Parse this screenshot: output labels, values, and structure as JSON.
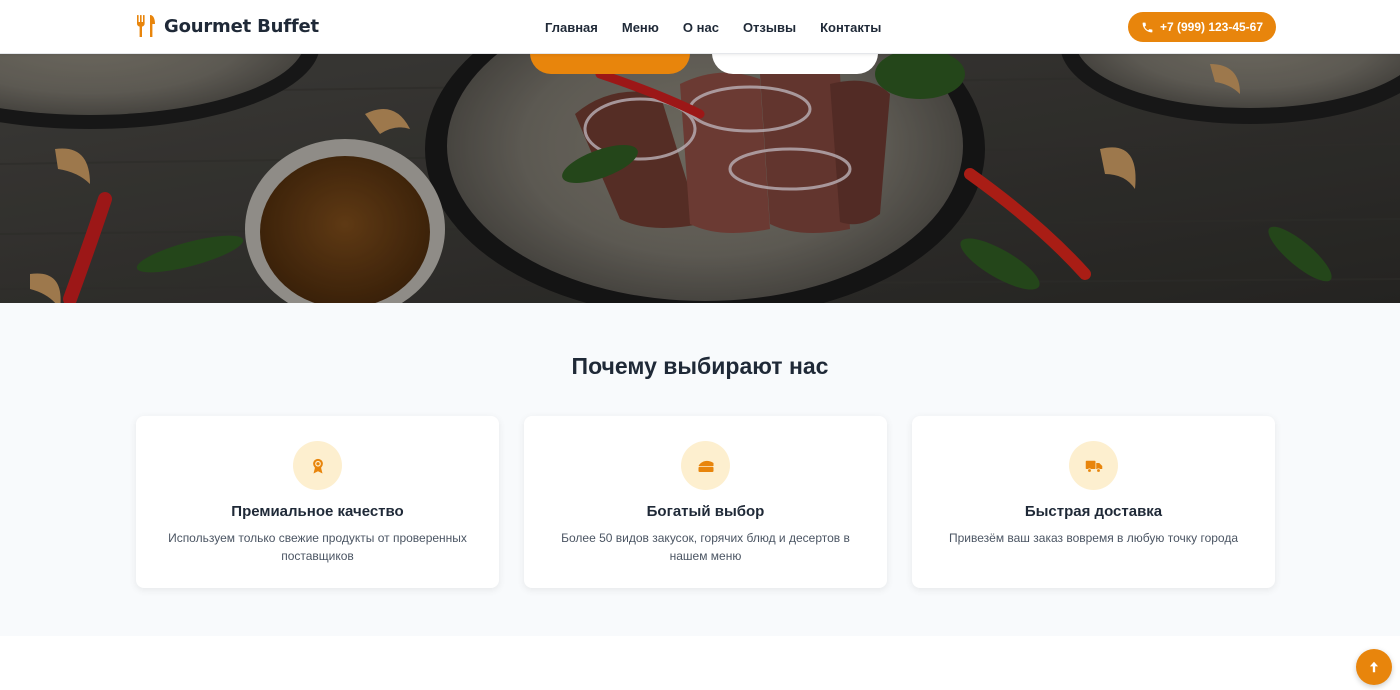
{
  "header": {
    "logo_text": "Gourmet Buffet",
    "logo_icon": "utensils-icon",
    "nav": [
      {
        "label": "Главная"
      },
      {
        "label": "Меню"
      },
      {
        "label": "О нас"
      },
      {
        "label": "Отзывы"
      },
      {
        "label": "Контакты"
      }
    ],
    "phone": "+7 (999) 123-45-67",
    "phone_icon": "phone-icon"
  },
  "hero": {
    "image": "steak-plate-photo"
  },
  "features": {
    "title": "Почему выбирают нас",
    "cards": [
      {
        "icon": "award-icon",
        "title": "Премиальное качество",
        "text": "Используем только свежие продукты от проверенных поставщиков"
      },
      {
        "icon": "cheese-icon",
        "title": "Богатый выбор",
        "text": "Более 50 видов закусок, горячих блюд и десертов в нашем меню"
      },
      {
        "icon": "truck-icon",
        "title": "Быстрая доставка",
        "text": "Привезём ваш заказ вовремя в любую точку города"
      }
    ]
  },
  "scroll_top_icon": "arrow-up-icon",
  "colors": {
    "accent": "#e8850c",
    "icon_bg": "#fdefcf",
    "section_bg": "#f8fafc",
    "text": "#1f2937"
  }
}
